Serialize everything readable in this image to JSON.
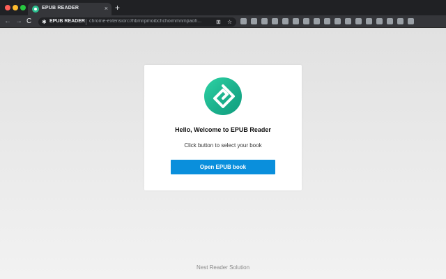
{
  "browser": {
    "tab": {
      "title": "EPUB READER",
      "close_glyph": "×"
    },
    "new_tab_glyph": "+",
    "nav": {
      "back_glyph": "←",
      "forward_glyph": "→",
      "reload_glyph": "C"
    },
    "omnibox": {
      "site_label": "EPUB READER",
      "url": "chrome-extension://hbmnpmoibchchoimmnmpaoh...",
      "puzzle_icon": "puzzle-icon",
      "translate_icon": "translate-icon",
      "star_icon": "star-icon"
    },
    "extension_icons": [
      "shield",
      "circle-i",
      "v",
      "download",
      "gear",
      "chrome",
      "alert",
      "mask",
      "pocket",
      "grid",
      "power",
      "s",
      "tag",
      "plus",
      "green",
      "box",
      "screen"
    ]
  },
  "page": {
    "logo_icon": "epub-logo-icon",
    "welcome": "Hello, Welcome to EPUB Reader",
    "subtitle": "Click button to select your book",
    "open_button": "Open EPUB book",
    "footer": "Nest Reader Solution"
  },
  "colors": {
    "primary_button": "#0a8fdc",
    "logo_green": "#1bb08c",
    "page_bg": "#e8e8e8"
  }
}
